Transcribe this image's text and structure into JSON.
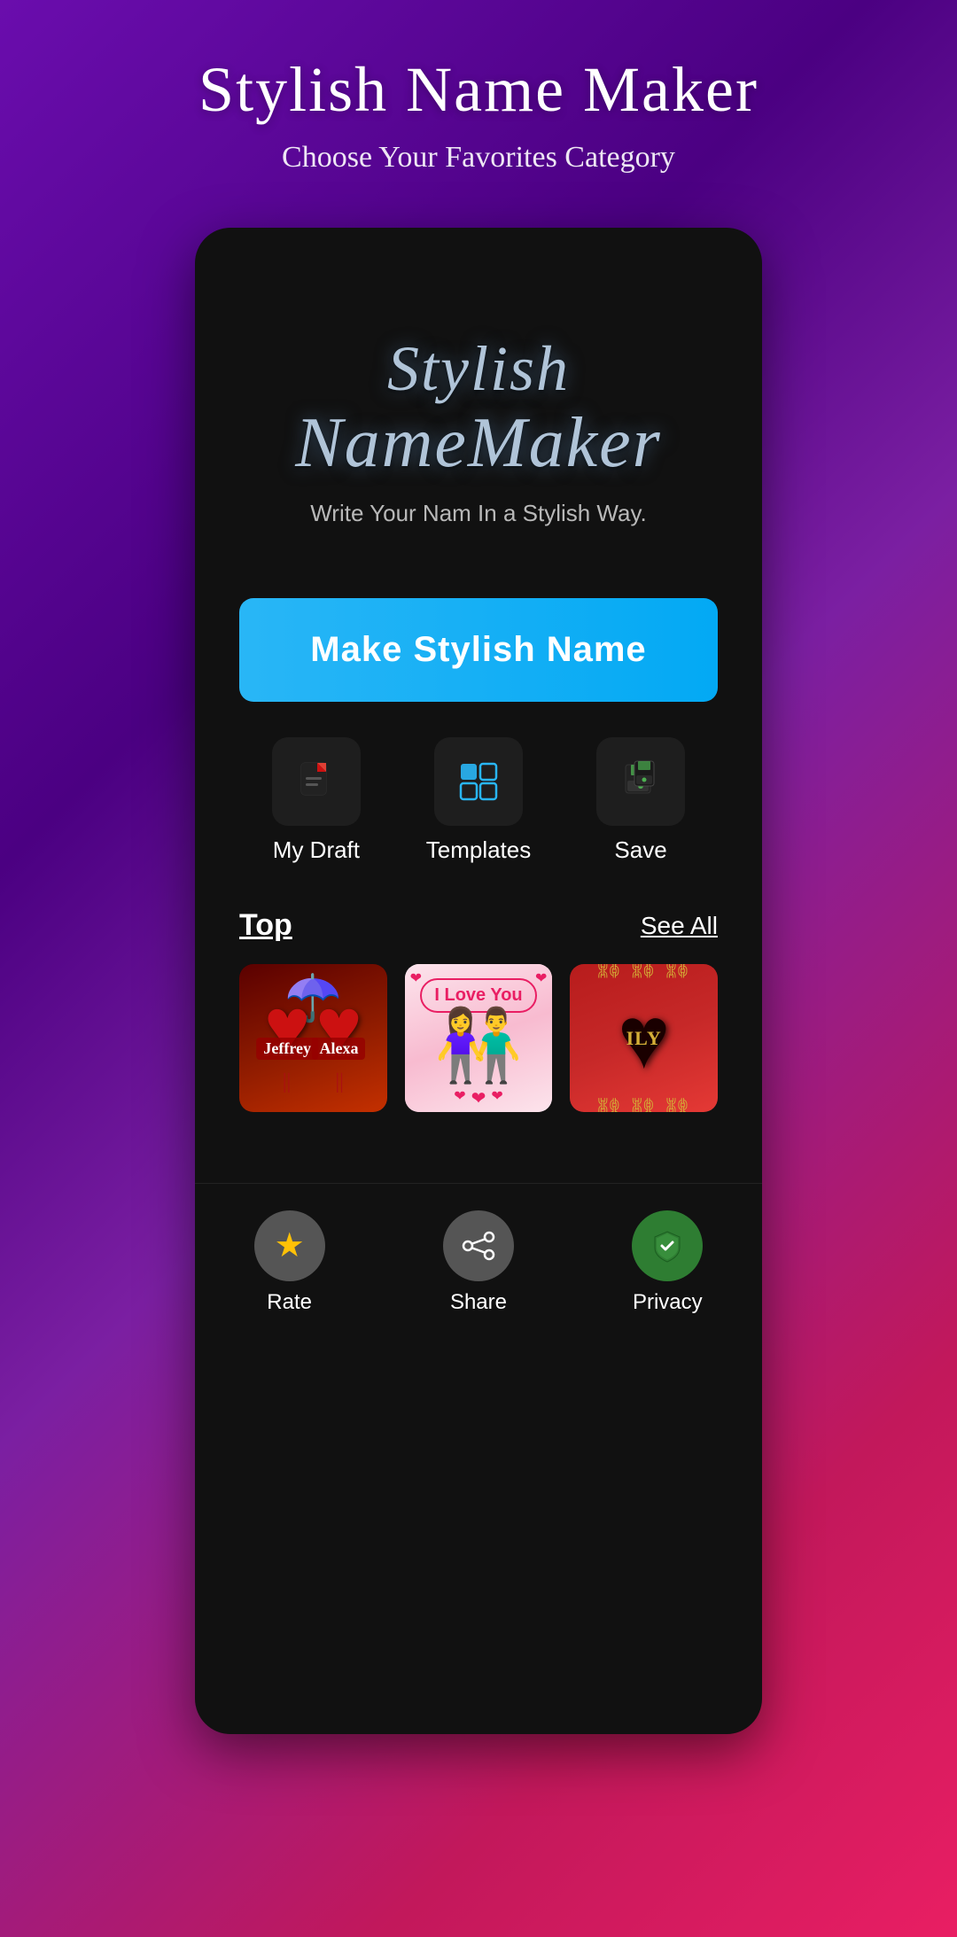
{
  "page": {
    "title": "Stylish Name Maker",
    "subtitle": "Choose Your Favorites Category"
  },
  "app": {
    "logo_line1": "Stylish",
    "logo_line2": "NameMaker",
    "tagline": "Write Your Nam In a Stylish Way."
  },
  "make_button": {
    "label": "Make Stylish Name"
  },
  "quick_actions": [
    {
      "id": "draft",
      "label": "My Draft",
      "icon": "📄"
    },
    {
      "id": "templates",
      "label": "Templates",
      "icon": "▦"
    },
    {
      "id": "save",
      "label": "Save",
      "icon": "💾"
    }
  ],
  "top_section": {
    "title": "Top",
    "see_all_label": "See All"
  },
  "template_cards": [
    {
      "id": "jeffrey-alexa",
      "name1": "Jeffrey",
      "name2": "Alexa",
      "alt": "Jeffrey Alexa heart couple template"
    },
    {
      "id": "love-you",
      "headline": "I Love You",
      "alt": "Love You couple template"
    },
    {
      "id": "locket",
      "alt": "Heart locket necklace template"
    }
  ],
  "bottom_nav": [
    {
      "id": "rate",
      "label": "Rate",
      "icon": "⭐",
      "icon_color": "#FFC107"
    },
    {
      "id": "share",
      "label": "Share",
      "icon": "↗",
      "icon_color": "#ffffff"
    },
    {
      "id": "privacy",
      "label": "Privacy",
      "icon": "🛡",
      "icon_color": "#4caf50"
    }
  ]
}
